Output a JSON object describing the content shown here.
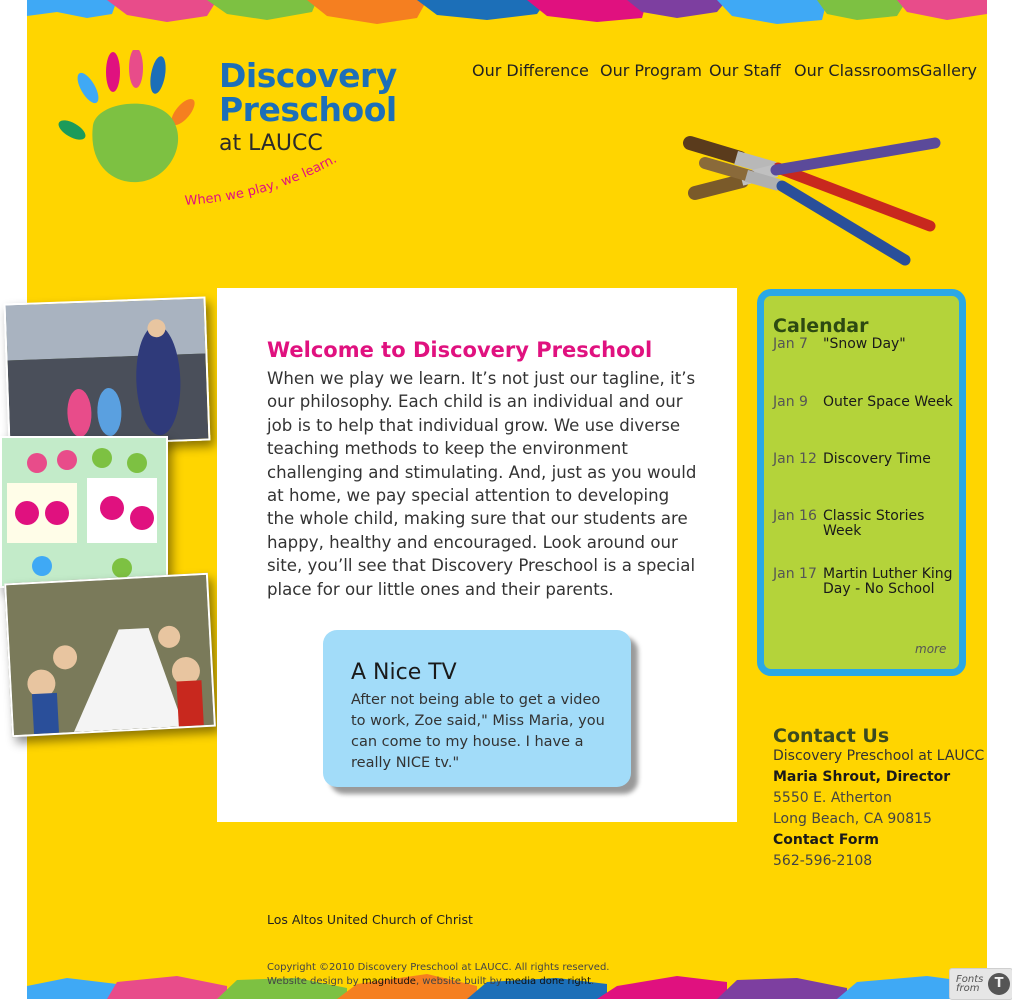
{
  "logo": {
    "line1": "Discovery",
    "line2": "Preschool",
    "line3": "at LAUCC",
    "tagline": "When we play, we learn."
  },
  "nav": {
    "items": [
      "Our Difference",
      "Our Program",
      "Our Staff",
      "Our Classrooms",
      "Gallery"
    ]
  },
  "welcome": {
    "title": "Welcome to Discovery Preschool",
    "body": "When we play we learn. It’s not just our tagline, it’s our philosophy. Each child is an individual and our job is to help that individual grow. We use diverse teaching methods to keep the environment challenging and stimulating. And, just as you would at home, we pay special attention to developing the whole child, making sure that our students are happy, healthy and encouraged. Look around our site, you’ll see that Discovery Preschool is a special place for our little ones and their parents."
  },
  "quote": {
    "title": "A Nice TV",
    "body": "After not being able to get a video to work, Zoe said,\" Miss Maria, you can come to my house. I have a really NICE tv.\""
  },
  "calendar": {
    "title": "Calendar",
    "events": [
      {
        "date": "Jan 7",
        "event": "\"Snow Day\""
      },
      {
        "date": "Jan 9",
        "event": "Outer Space Week"
      },
      {
        "date": "Jan 12",
        "event": "Discovery Time"
      },
      {
        "date": "Jan 16",
        "event": "Classic Stories Week"
      },
      {
        "date": "Jan 17",
        "event": "Martin Luther King Day - No School"
      }
    ],
    "more": "more"
  },
  "contact": {
    "title": "Contact Us",
    "name": "Discovery Preschool at LAUCC",
    "director": "Maria Shrout, Director",
    "address1": "5550 E. Atherton",
    "address2": "Long Beach, CA 90815",
    "form": "Contact Form",
    "phone": "562-596-2108"
  },
  "footer": {
    "church": "Los Altos United Church of Christ",
    "copyright": "Copyright ©2010 Discovery Preschool at LAUCC. All rights reserved.",
    "design_prefix": "Website design by",
    "design_link": "magnitude",
    "built_prefix": ", website built by",
    "built_link": "media done right",
    "built_suffix": "."
  },
  "badge": {
    "text": "Fonts from"
  },
  "colors": {
    "page_bg": "#ffd500",
    "logo_blue": "#1c6fb8",
    "welcome_pink": "#e0117f",
    "calendar_green": "#b4d33a",
    "calendar_border": "#2aa8e6",
    "quote_blue": "#a2dcf9"
  }
}
